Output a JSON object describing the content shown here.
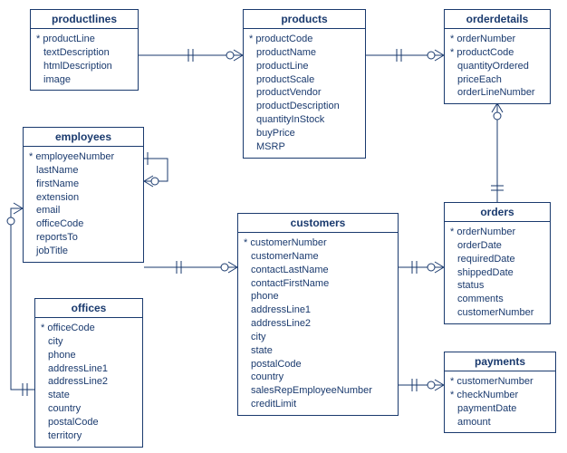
{
  "entities": {
    "productlines": {
      "title": "productlines",
      "attrs": [
        {
          "name": "productLine",
          "pk": true
        },
        {
          "name": "textDescription",
          "pk": false
        },
        {
          "name": "htmlDescription",
          "pk": false
        },
        {
          "name": "image",
          "pk": false
        }
      ]
    },
    "products": {
      "title": "products",
      "attrs": [
        {
          "name": "productCode",
          "pk": true
        },
        {
          "name": "productName",
          "pk": false
        },
        {
          "name": "productLine",
          "pk": false
        },
        {
          "name": "productScale",
          "pk": false
        },
        {
          "name": "productVendor",
          "pk": false
        },
        {
          "name": "productDescription",
          "pk": false
        },
        {
          "name": "quantityInStock",
          "pk": false
        },
        {
          "name": "buyPrice",
          "pk": false
        },
        {
          "name": "MSRP",
          "pk": false
        }
      ]
    },
    "orderdetails": {
      "title": "orderdetails",
      "attrs": [
        {
          "name": "orderNumber",
          "pk": true
        },
        {
          "name": "productCode",
          "pk": true
        },
        {
          "name": "quantityOrdered",
          "pk": false
        },
        {
          "name": "priceEach",
          "pk": false
        },
        {
          "name": "orderLineNumber",
          "pk": false
        }
      ]
    },
    "employees": {
      "title": "employees",
      "attrs": [
        {
          "name": "employeeNumber",
          "pk": true
        },
        {
          "name": "lastName",
          "pk": false
        },
        {
          "name": "firstName",
          "pk": false
        },
        {
          "name": "extension",
          "pk": false
        },
        {
          "name": "email",
          "pk": false
        },
        {
          "name": "officeCode",
          "pk": false
        },
        {
          "name": "reportsTo",
          "pk": false
        },
        {
          "name": "jobTitle",
          "pk": false
        }
      ]
    },
    "customers": {
      "title": "customers",
      "attrs": [
        {
          "name": "customerNumber",
          "pk": true
        },
        {
          "name": "customerName",
          "pk": false
        },
        {
          "name": "contactLastName",
          "pk": false
        },
        {
          "name": "contactFirstName",
          "pk": false
        },
        {
          "name": "phone",
          "pk": false
        },
        {
          "name": "addressLine1",
          "pk": false
        },
        {
          "name": "addressLine2",
          "pk": false
        },
        {
          "name": "city",
          "pk": false
        },
        {
          "name": "state",
          "pk": false
        },
        {
          "name": "postalCode",
          "pk": false
        },
        {
          "name": "country",
          "pk": false
        },
        {
          "name": "salesRepEmployeeNumber",
          "pk": false
        },
        {
          "name": "creditLimit",
          "pk": false
        }
      ]
    },
    "orders": {
      "title": "orders",
      "attrs": [
        {
          "name": "orderNumber",
          "pk": true
        },
        {
          "name": "orderDate",
          "pk": false
        },
        {
          "name": "requiredDate",
          "pk": false
        },
        {
          "name": "shippedDate",
          "pk": false
        },
        {
          "name": "status",
          "pk": false
        },
        {
          "name": "comments",
          "pk": false
        },
        {
          "name": "customerNumber",
          "pk": false
        }
      ]
    },
    "offices": {
      "title": "offices",
      "attrs": [
        {
          "name": "officeCode",
          "pk": true
        },
        {
          "name": "city",
          "pk": false
        },
        {
          "name": "phone",
          "pk": false
        },
        {
          "name": "addressLine1",
          "pk": false
        },
        {
          "name": "addressLine2",
          "pk": false
        },
        {
          "name": "state",
          "pk": false
        },
        {
          "name": "country",
          "pk": false
        },
        {
          "name": "postalCode",
          "pk": false
        },
        {
          "name": "territory",
          "pk": false
        }
      ]
    },
    "payments": {
      "title": "payments",
      "attrs": [
        {
          "name": "customerNumber",
          "pk": true
        },
        {
          "name": "checkNumber",
          "pk": true
        },
        {
          "name": "paymentDate",
          "pk": false
        },
        {
          "name": "amount",
          "pk": false
        }
      ]
    }
  },
  "relationships": [
    {
      "from": "productlines",
      "to": "products",
      "card": "one-to-many"
    },
    {
      "from": "products",
      "to": "orderdetails",
      "card": "one-to-many"
    },
    {
      "from": "orderdetails",
      "to": "orders",
      "card": "many-to-one"
    },
    {
      "from": "customers",
      "to": "orders",
      "card": "one-to-many"
    },
    {
      "from": "customers",
      "to": "payments",
      "card": "one-to-many"
    },
    {
      "from": "employees",
      "to": "customers",
      "card": "one-to-many"
    },
    {
      "from": "employees",
      "to": "employees",
      "card": "self-one-to-many"
    },
    {
      "from": "offices",
      "to": "employees",
      "card": "one-to-many"
    }
  ]
}
